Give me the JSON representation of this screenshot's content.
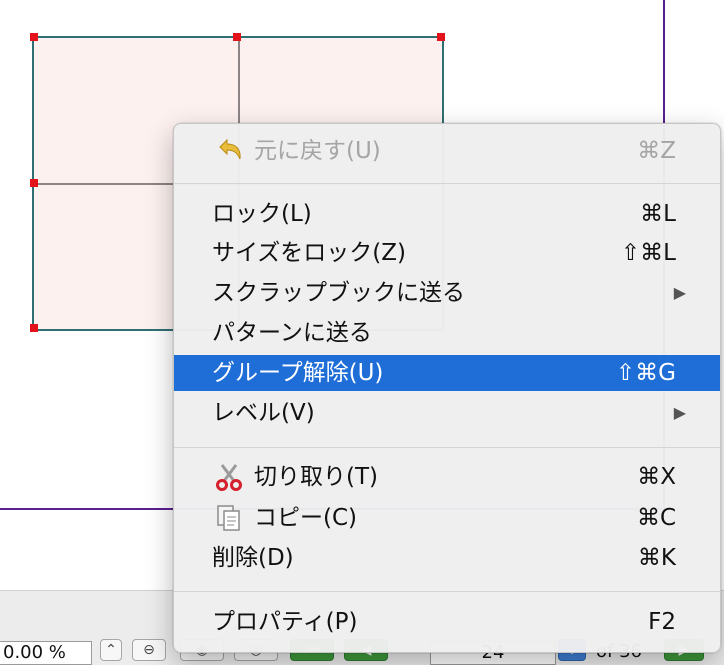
{
  "menu": {
    "items": [
      {
        "label": "元に戻す(U)",
        "shortcut": "⌘Z",
        "icon": "undo-arrow-icon",
        "disabled": true
      },
      {
        "label": "ロック(L)",
        "shortcut": "⌘L"
      },
      {
        "label": "サイズをロック(Z)",
        "shortcut": "⇧⌘L"
      },
      {
        "label": "スクラップブックに送る",
        "submenu": true
      },
      {
        "label": "パターンに送る"
      },
      {
        "label": "グループ解除(U)",
        "shortcut": "⇧⌘G",
        "highlighted": true
      },
      {
        "label": "レベル(V)",
        "submenu": true
      },
      {
        "label": "切り取り(T)",
        "shortcut": "⌘X",
        "icon": "scissors-icon"
      },
      {
        "label": "コピー(C)",
        "shortcut": "⌘C",
        "icon": "copy-document-icon"
      },
      {
        "label": "削除(D)",
        "shortcut": "⌘K"
      },
      {
        "label": "プロパティ(P)",
        "shortcut": "F2"
      }
    ],
    "submenu_arrow": "▶"
  },
  "statusbar": {
    "zoom_value": "0.00 %",
    "page_value": "24",
    "page_total": "of 36"
  },
  "colors": {
    "highlight": "#1f6ed8",
    "shape_fill": "#fdf1f0",
    "shape_border": "#2f6f73",
    "guide": "#5a1f8f",
    "handle": "#e3131b"
  }
}
